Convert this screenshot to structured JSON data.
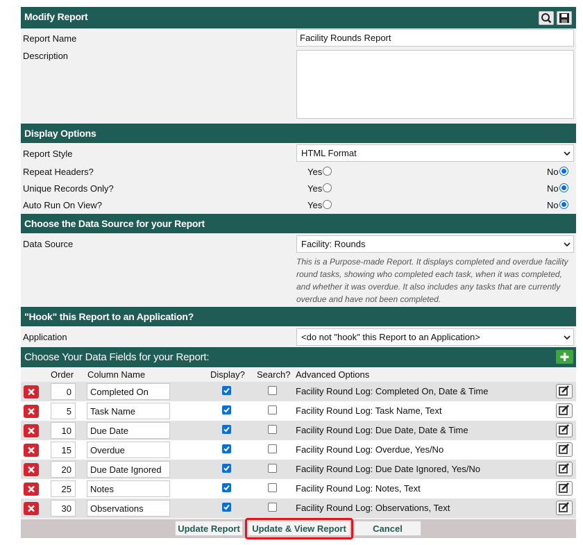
{
  "header": {
    "title": "Modify Report",
    "search_icon": "search-icon",
    "save_icon": "save-icon"
  },
  "report": {
    "name_label": "Report Name",
    "name_value": "Facility Rounds Report",
    "description_label": "Description",
    "description_value": ""
  },
  "display_options": {
    "title": "Display Options",
    "style_label": "Report Style",
    "style_value": "HTML Format",
    "yes_label": "Yes",
    "no_label": "No",
    "repeat_headers_label": "Repeat Headers?",
    "repeat_headers_value": "No",
    "unique_records_label": "Unique Records Only?",
    "unique_records_value": "No",
    "auto_run_label": "Auto Run On View?",
    "auto_run_value": "No"
  },
  "data_source": {
    "title": "Choose the Data Source for your Report",
    "label": "Data Source",
    "value": "Facility: Rounds",
    "note": "This is a Purpose-made Report. It displays completed and overdue facility round tasks, showing who completed each task, when it was completed, and whether it was overdue. It also includes any tasks that are currently overdue and have not been completed."
  },
  "hook": {
    "title": "\"Hook\" this Report to an Application?",
    "label": "Application",
    "value": "<do not \"hook\" this Report to an Application>"
  },
  "fields": {
    "title": "Choose Your Data Fields for your Report:",
    "add_icon": "plus-icon",
    "headers": {
      "order": "Order",
      "column_name": "Column Name",
      "display": "Display?",
      "search": "Search?",
      "advanced": "Advanced Options"
    },
    "rows": [
      {
        "order": "0",
        "name": "Completed On",
        "display": true,
        "search": false,
        "advanced": "Facility Round Log: Completed On, Date & Time"
      },
      {
        "order": "5",
        "name": "Task Name",
        "display": true,
        "search": false,
        "advanced": "Facility Round Log: Task Name, Text"
      },
      {
        "order": "10",
        "name": "Due Date",
        "display": true,
        "search": false,
        "advanced": "Facility Round Log: Due Date, Date & Time"
      },
      {
        "order": "15",
        "name": "Overdue",
        "display": true,
        "search": false,
        "advanced": "Facility Round Log: Overdue, Yes/No"
      },
      {
        "order": "20",
        "name": "Due Date Ignored",
        "display": true,
        "search": false,
        "advanced": "Facility Round Log: Due Date Ignored, Yes/No"
      },
      {
        "order": "25",
        "name": "Notes",
        "display": true,
        "search": false,
        "advanced": "Facility Round Log: Notes, Text"
      },
      {
        "order": "30",
        "name": "Observations",
        "display": true,
        "search": false,
        "advanced": "Facility Round Log: Observations, Text"
      }
    ]
  },
  "footer": {
    "update_label": "Update Report",
    "update_view_label": "Update & View Report",
    "cancel_label": "Cancel"
  },
  "colors": {
    "header_bg": "#1f5c55",
    "delete_red": "#d9232f",
    "add_green": "#3aa83a",
    "highlight_red": "#e0181e",
    "check_blue": "#0a6fd8"
  }
}
